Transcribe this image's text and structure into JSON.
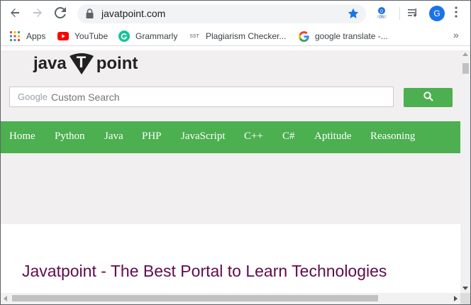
{
  "browser": {
    "url": "javatpoint.com",
    "icons": {
      "back": "back-arrow-icon",
      "forward": "forward-arrow-icon",
      "reload": "reload-icon",
      "lock": "lock-icon",
      "bookmark_star": "star-icon",
      "extension": "extension-icon",
      "media": "media-control-icon",
      "menu": "more-vert-icon"
    },
    "profile_initial": "G",
    "accent_color": "#1a73e8"
  },
  "bookmarks": {
    "items": [
      {
        "label": "Apps",
        "icon": "apps-grid-icon"
      },
      {
        "label": "YouTube",
        "icon": "youtube-icon"
      },
      {
        "label": "Grammarly",
        "icon": "grammarly-icon"
      },
      {
        "label": "Plagiarism Checker...",
        "icon": "sst-icon",
        "icon_text": "SST"
      },
      {
        "label": "google translate -...",
        "icon": "google-icon"
      }
    ],
    "overflow": "»"
  },
  "site": {
    "logo": {
      "left": "java",
      "badge": "T",
      "right": "point"
    },
    "search": {
      "brand": "Google",
      "placeholder": "Custom Search",
      "button_icon": "search-icon"
    },
    "menu": [
      "Home",
      "Python",
      "Java",
      "PHP",
      "JavaScript",
      "C++",
      "C#",
      "Aptitude",
      "Reasoning"
    ],
    "title": "Javatpoint - The Best Portal to Learn Technologies",
    "colors": {
      "menu_bg": "#4caf50",
      "header_bg": "#f1efef",
      "title": "#610b4b"
    }
  }
}
